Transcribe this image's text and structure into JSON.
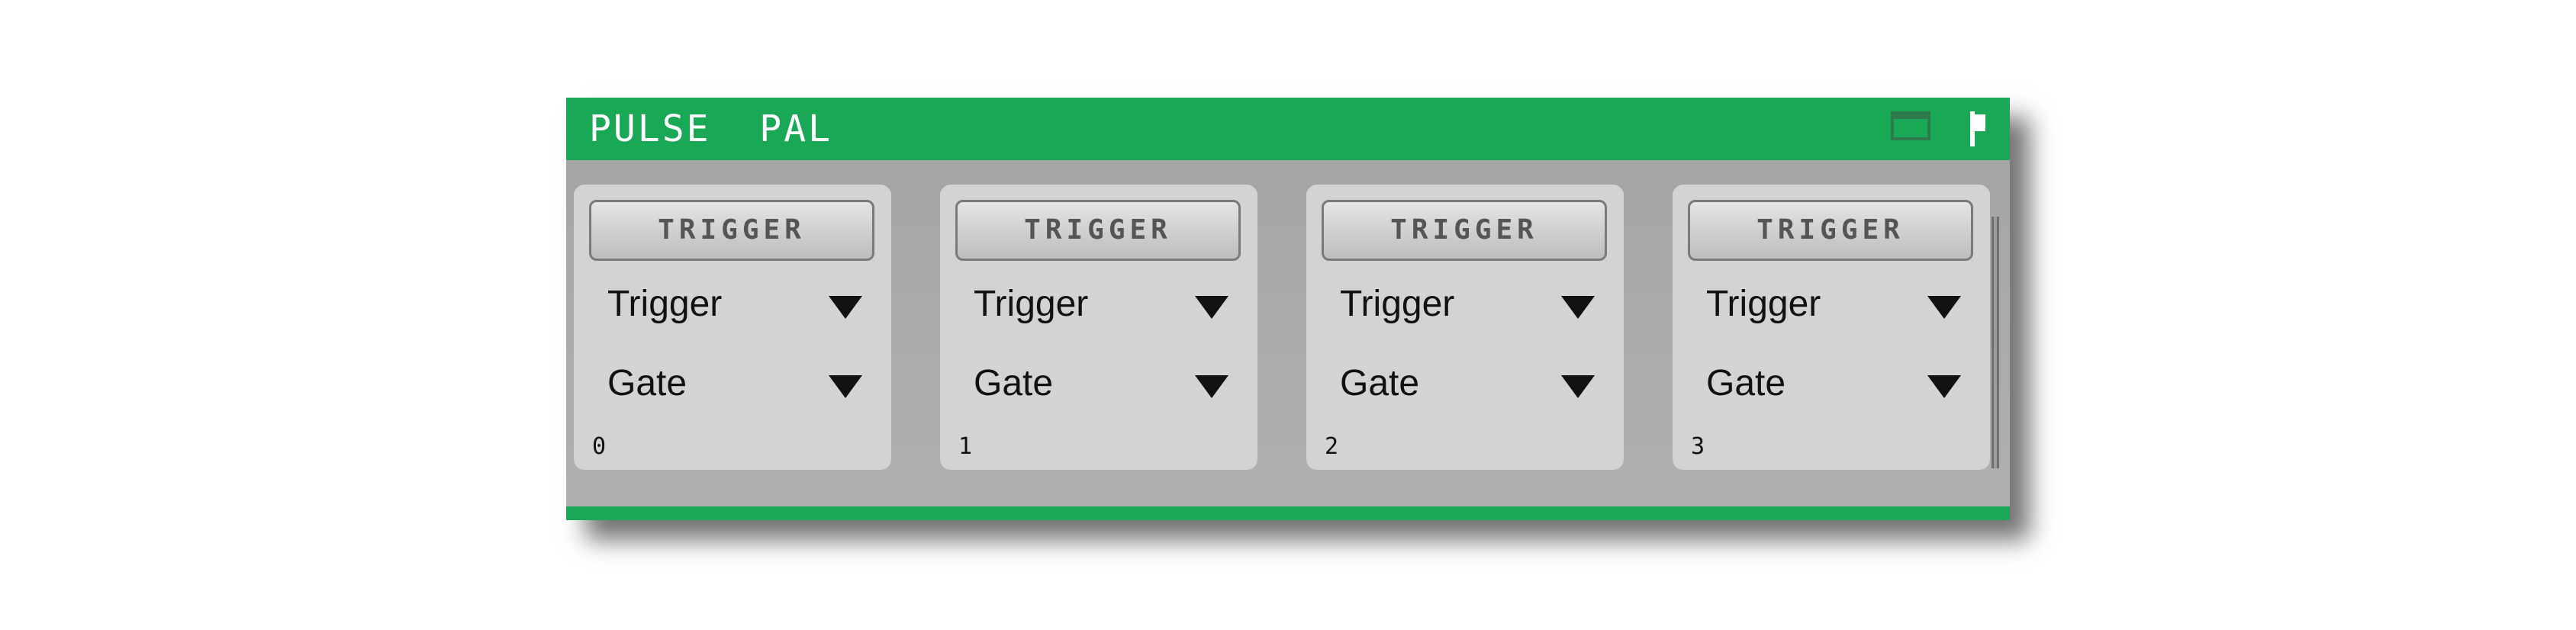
{
  "window": {
    "title": "PULSE  PAL",
    "title_icons": [
      "window-mode-icon",
      "pin-icon"
    ],
    "accent_color": "#19a855"
  },
  "channels": [
    {
      "number": "0",
      "trigger_label": "TRIGGER",
      "mode": "Trigger",
      "output": "Gate"
    },
    {
      "number": "1",
      "trigger_label": "TRIGGER",
      "mode": "Trigger",
      "output": "Gate"
    },
    {
      "number": "2",
      "trigger_label": "TRIGGER",
      "mode": "Trigger",
      "output": "Gate"
    },
    {
      "number": "3",
      "trigger_label": "TRIGGER",
      "mode": "Trigger",
      "output": "Gate"
    }
  ]
}
